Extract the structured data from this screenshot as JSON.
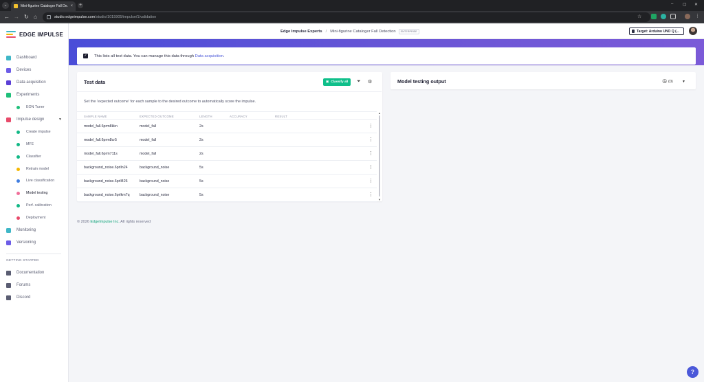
{
  "browser": {
    "tab_title": "Mini-figurine Cataloger Fall De...",
    "url_host": "studio.edgeimpulse.com",
    "url_path": "/studio/1015905/impulse/1/validation"
  },
  "sidebar": {
    "brand": "EDGE IMPULSE",
    "items": [
      {
        "label": "Dashboard",
        "icon": "monitor-icon",
        "color": "#3fb7c7"
      },
      {
        "label": "Devices",
        "icon": "cpu-icon",
        "color": "#6c5ce7"
      },
      {
        "label": "Data acquisition",
        "icon": "database-icon",
        "color": "#5b3fd6"
      },
      {
        "label": "Experiments",
        "icon": "grid-icon",
        "color": "#1fbf7a"
      },
      {
        "label": "EON Tuner",
        "icon": "tuner-icon",
        "color": "#1fbf7a"
      },
      {
        "label": "Impulse design",
        "icon": "pulse-icon",
        "color": "#e84a6a"
      },
      {
        "label": "Create impulse",
        "icon": "dot-icon",
        "color": "#12b886"
      },
      {
        "label": "MFE",
        "icon": "dot-icon",
        "color": "#12b886"
      },
      {
        "label": "Classifier",
        "icon": "dot-icon",
        "color": "#12b886"
      },
      {
        "label": "Retrain model",
        "icon": "retrain-icon",
        "color": "#f5b700"
      },
      {
        "label": "Live classification",
        "icon": "live-icon",
        "color": "#3f7de0"
      },
      {
        "label": "Model testing",
        "icon": "testing-icon",
        "color": "#f06f9a"
      },
      {
        "label": "Perf. calibration",
        "icon": "calibration-icon",
        "color": "#12b886"
      },
      {
        "label": "Deployment",
        "icon": "deploy-icon",
        "color": "#e84a6a"
      },
      {
        "label": "Monitoring",
        "icon": "monitoring-icon",
        "color": "#3fb7c7"
      },
      {
        "label": "Versioning",
        "icon": "versioning-icon",
        "color": "#6c5ce7"
      }
    ],
    "getting_started_title": "GETTING STARTED",
    "getting_started": [
      {
        "label": "Documentation",
        "icon": "docs-icon"
      },
      {
        "label": "Forums",
        "icon": "forums-icon"
      },
      {
        "label": "Discord",
        "icon": "discord-icon"
      }
    ]
  },
  "header": {
    "org": "Edge Impulse Experts",
    "separator": "/",
    "project": "Mini-figurine Cataloger Fall Detection",
    "badge": "ENTERPRISE",
    "target": "Target: Arduino UNO Q (..."
  },
  "info": {
    "text": "This lists all test data. You can manage this data through",
    "link": "Data acquisition",
    "suffix": "."
  },
  "test_data": {
    "title": "Test data",
    "classify_all": "Classify all",
    "description": "Set the 'expected outcome' for each sample to the desired outcome to automatically score the impulse.",
    "columns": [
      "SAMPLE NAME",
      "EXPECTED OUTCOME",
      "LENGTH",
      "ACCURACY",
      "RESULT"
    ],
    "rows": [
      {
        "name": "model_fall.6prm8kkn",
        "expected": "model_fall",
        "length": "2s"
      },
      {
        "name": "model_fall.6prm8cr5",
        "expected": "model_fall",
        "length": "2s"
      },
      {
        "name": "model_fall.6prm711s",
        "expected": "model_fall",
        "length": "2s"
      },
      {
        "name": "background_noise.6prlln24",
        "expected": "background_noise",
        "length": "5s"
      },
      {
        "name": "background_noise.6prll426",
        "expected": "background_noise",
        "length": "5s"
      },
      {
        "name": "background_noise.6prlkm7q",
        "expected": "background_noise",
        "length": "5s"
      }
    ]
  },
  "output": {
    "title": "Model testing output",
    "count": "(0)"
  },
  "footer": {
    "prefix": "© 2026",
    "company": "EdgeImpulse Inc.",
    "suffix": "All rights reserved"
  },
  "colors": {
    "accent": "#4b58d9",
    "success": "#0fbf8a",
    "hero_start": "#4a4dd8",
    "hero_end": "#7b5ad8"
  }
}
